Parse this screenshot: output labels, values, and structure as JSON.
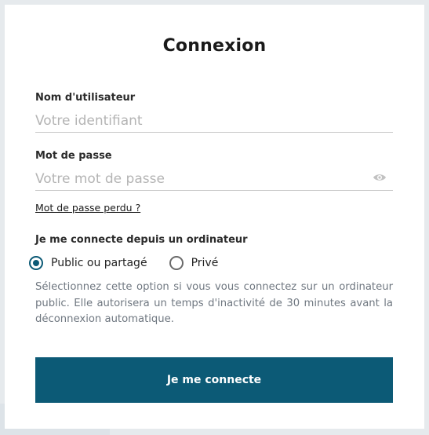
{
  "form": {
    "title": "Connexion",
    "username": {
      "label": "Nom d'utilisateur",
      "placeholder": "Votre identifiant"
    },
    "password": {
      "label": "Mot de passe",
      "placeholder": "Votre mot de passe",
      "toggle_icon": "eye-icon"
    },
    "forgot_link": "Mot de passe perdu ?",
    "device_question": "Je me connecte depuis un ordinateur",
    "device_options": [
      {
        "label": "Public ou partagé",
        "selected": true
      },
      {
        "label": "Privé",
        "selected": false
      }
    ],
    "device_help": "Sélectionnez cette option si vous vous connectez sur un ordinateur public. Elle autorisera un temps d'inactivité de 30 minutes avant la déconnexion automatique.",
    "submit_label": "Je me connecte"
  },
  "colors": {
    "accent": "#0c5a76",
    "background": "#e6eaed",
    "card": "#ffffff"
  }
}
